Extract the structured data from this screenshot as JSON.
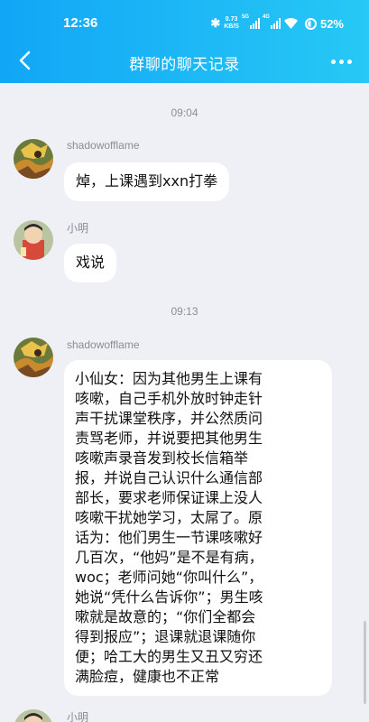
{
  "status_bar": {
    "time": "12:36",
    "net_speed_value": "0.73",
    "net_speed_unit": "KB/S",
    "signal1_tag": "5G",
    "signal2_tag": "4G",
    "battery": "52%"
  },
  "nav": {
    "title": "群聊的聊天记录",
    "back_icon": "chevron-left-icon",
    "more_icon": "more-dots-icon"
  },
  "colors": {
    "header_start": "#12a6f6",
    "header_end": "#27c8f5",
    "bg": "#eef0f6"
  },
  "messages": [
    {
      "time": "09:04"
    },
    {
      "sender": "shadowofflame",
      "text": "焯，上课遇到xxn打拳"
    },
    {
      "sender": "小明",
      "text": "戏说"
    },
    {
      "time": "09:13"
    },
    {
      "sender": "shadowofflame",
      "lines": [
        "小仙女：因为其他男生上课有",
        "咳嗽，自己手机外放时钟走针",
        "声干扰课堂秩序，并公然质问",
        "责骂老师，并说要把其他男生",
        "咳嗽声录音发到校长信箱举",
        "报，并说自己认识什么通信部",
        "部长，要求老师保证课上没人",
        "咳嗽干扰她学习，太屌了。原",
        "话为：他们男生一节课咳嗽好",
        "几百次，“他妈”是不是有病，",
        "woc；老师问她“你叫什么”，",
        "她说“凭什么告诉你”；男生咳",
        "嗽就是故意的；“你们全都会",
        "得到报应”；退课就退课随你",
        "便；哈工大的男生又丑又穷还",
        "满脸痘，健康也不正常"
      ]
    },
    {
      "sender": "小明"
    }
  ]
}
